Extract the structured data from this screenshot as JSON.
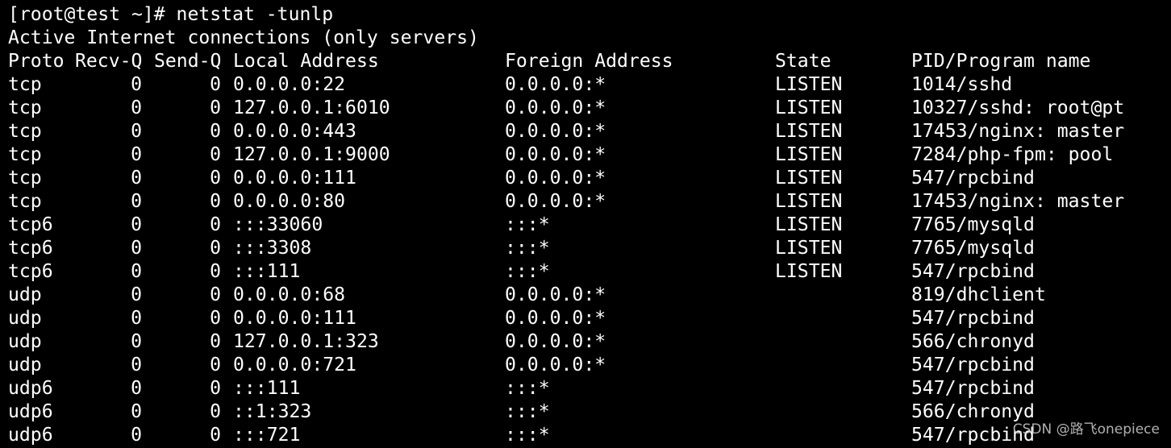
{
  "terminal": {
    "background": "#000000",
    "foreground": "#ffffff",
    "prompt": "[root@test ~]# netstat -tunlp",
    "subtitle": "Active Internet connections (only servers)",
    "columns": [
      "Proto",
      "Recv-Q",
      "Send-Q",
      "Local Address",
      "Foreign Address",
      "State",
      "PID/Program name"
    ],
    "rows": [
      {
        "proto": "tcp",
        "recv": "0",
        "send": "0",
        "local": "0.0.0.0:22",
        "foreign": "0.0.0.0:*",
        "state": "LISTEN",
        "pid": "1014/sshd"
      },
      {
        "proto": "tcp",
        "recv": "0",
        "send": "0",
        "local": "127.0.0.1:6010",
        "foreign": "0.0.0.0:*",
        "state": "LISTEN",
        "pid": "10327/sshd: root@pt"
      },
      {
        "proto": "tcp",
        "recv": "0",
        "send": "0",
        "local": "0.0.0.0:443",
        "foreign": "0.0.0.0:*",
        "state": "LISTEN",
        "pid": "17453/nginx: master"
      },
      {
        "proto": "tcp",
        "recv": "0",
        "send": "0",
        "local": "127.0.0.1:9000",
        "foreign": "0.0.0.0:*",
        "state": "LISTEN",
        "pid": "7284/php-fpm: pool"
      },
      {
        "proto": "tcp",
        "recv": "0",
        "send": "0",
        "local": "0.0.0.0:111",
        "foreign": "0.0.0.0:*",
        "state": "LISTEN",
        "pid": "547/rpcbind"
      },
      {
        "proto": "tcp",
        "recv": "0",
        "send": "0",
        "local": "0.0.0.0:80",
        "foreign": "0.0.0.0:*",
        "state": "LISTEN",
        "pid": "17453/nginx: master"
      },
      {
        "proto": "tcp6",
        "recv": "0",
        "send": "0",
        "local": ":::33060",
        "foreign": ":::*",
        "state": "LISTEN",
        "pid": "7765/mysqld"
      },
      {
        "proto": "tcp6",
        "recv": "0",
        "send": "0",
        "local": ":::3308",
        "foreign": ":::*",
        "state": "LISTEN",
        "pid": "7765/mysqld"
      },
      {
        "proto": "tcp6",
        "recv": "0",
        "send": "0",
        "local": ":::111",
        "foreign": ":::*",
        "state": "LISTEN",
        "pid": "547/rpcbind"
      },
      {
        "proto": "udp",
        "recv": "0",
        "send": "0",
        "local": "0.0.0.0:68",
        "foreign": "0.0.0.0:*",
        "state": "",
        "pid": "819/dhclient"
      },
      {
        "proto": "udp",
        "recv": "0",
        "send": "0",
        "local": "0.0.0.0:111",
        "foreign": "0.0.0.0:*",
        "state": "",
        "pid": "547/rpcbind"
      },
      {
        "proto": "udp",
        "recv": "0",
        "send": "0",
        "local": "127.0.0.1:323",
        "foreign": "0.0.0.0:*",
        "state": "",
        "pid": "566/chronyd"
      },
      {
        "proto": "udp",
        "recv": "0",
        "send": "0",
        "local": "0.0.0.0:721",
        "foreign": "0.0.0.0:*",
        "state": "",
        "pid": "547/rpcbind"
      },
      {
        "proto": "udp6",
        "recv": "0",
        "send": "0",
        "local": ":::111",
        "foreign": ":::*",
        "state": "",
        "pid": "547/rpcbind"
      },
      {
        "proto": "udp6",
        "recv": "0",
        "send": "0",
        "local": "::1:323",
        "foreign": ":::*",
        "state": "",
        "pid": "566/chronyd"
      },
      {
        "proto": "udp6",
        "recv": "0",
        "send": "0",
        "local": ":::721",
        "foreign": ":::*",
        "state": "",
        "pid": "547/rpcbind"
      }
    ]
  },
  "watermark": "CSDN @路飞onepiece"
}
